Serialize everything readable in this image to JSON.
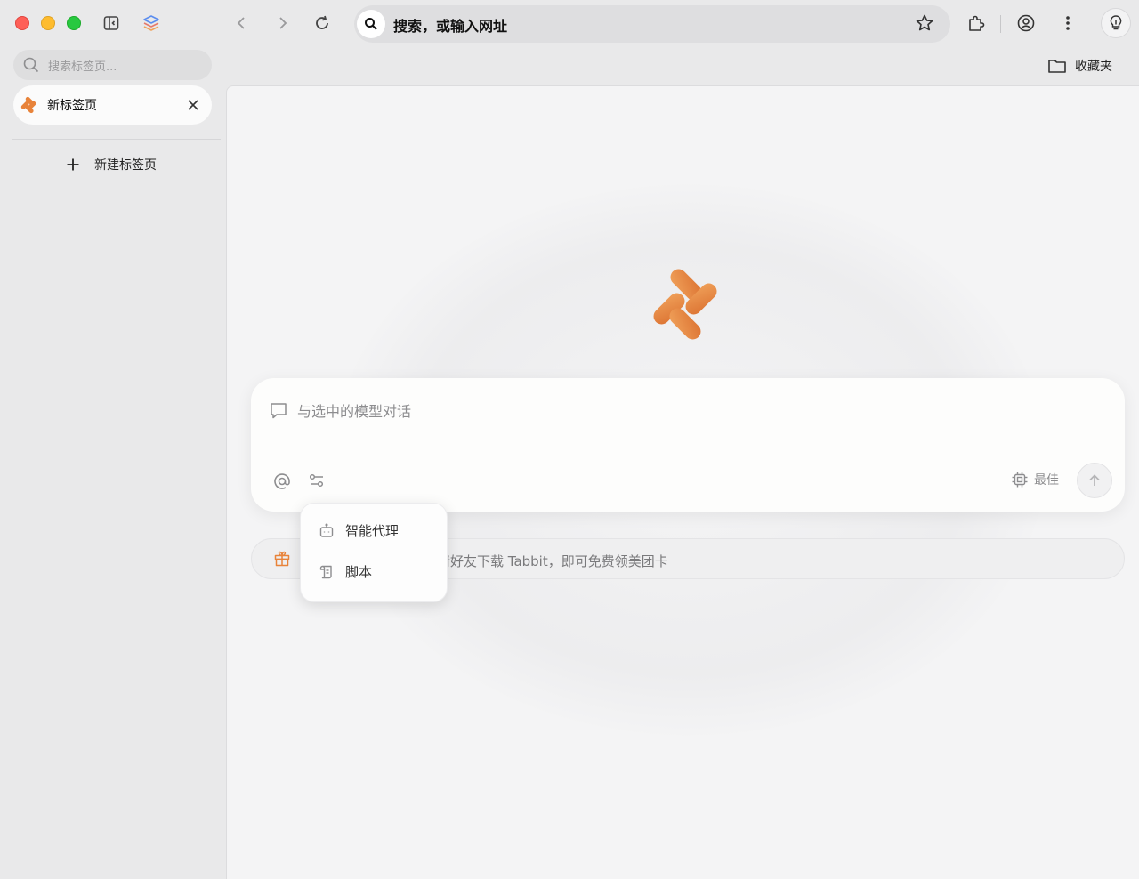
{
  "toolbar": {
    "address_text": "搜索，或输入网址",
    "favorites_label": "收藏夹"
  },
  "sidebar": {
    "search_placeholder": "搜索标签页...",
    "tabs": [
      {
        "title": "新标签页",
        "active": true
      }
    ],
    "new_tab_label": "新建标签页"
  },
  "main": {
    "chat": {
      "placeholder": "与选中的模型对话",
      "model_label": "最佳"
    },
    "promo_text": "请好友下载 Tabbit，即可免费领美团卡",
    "dropdown": {
      "items": [
        {
          "label": "智能代理",
          "icon": "robot-icon"
        },
        {
          "label": "脚本",
          "icon": "script-icon"
        }
      ]
    }
  },
  "colors": {
    "brand_orange": "#e8833a",
    "traffic_red": "#fe5f57",
    "traffic_yellow": "#febc2e",
    "traffic_green": "#28c840"
  }
}
